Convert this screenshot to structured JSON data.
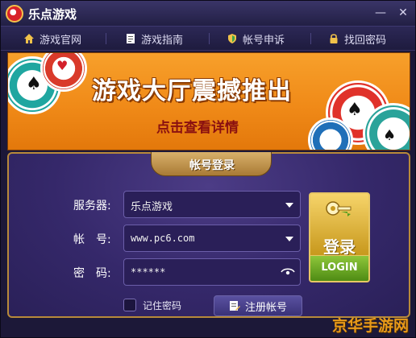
{
  "window": {
    "title": "乐点游戏",
    "minimize_glyph": "—",
    "close_glyph": "✕"
  },
  "nav": {
    "items": [
      {
        "label": "游戏官网",
        "icon": "home-icon"
      },
      {
        "label": "游戏指南",
        "icon": "guide-icon"
      },
      {
        "label": "帐号申诉",
        "icon": "shield-icon"
      },
      {
        "label": "找回密码",
        "icon": "lock-icon"
      }
    ]
  },
  "banner": {
    "headline": "游戏大厅震撼推出",
    "subtitle": "点击查看详情"
  },
  "login": {
    "section_title": "帐号登录",
    "server_label": "服务器:",
    "server_value": "乐点游戏",
    "account_label": "帐　号:",
    "account_value": "www.pc6.com",
    "password_label": "密　码:",
    "password_value": "******",
    "login_button": {
      "cn": "登录",
      "en": "LOGIN"
    },
    "remember_label": "记住密码",
    "register_button": "注册帐号"
  },
  "watermark": "京华手游网",
  "colors": {
    "accent_orange": "#f08a18",
    "panel_purple": "#35286a",
    "gold": "#e8c765",
    "login_green": "#6aa828"
  }
}
